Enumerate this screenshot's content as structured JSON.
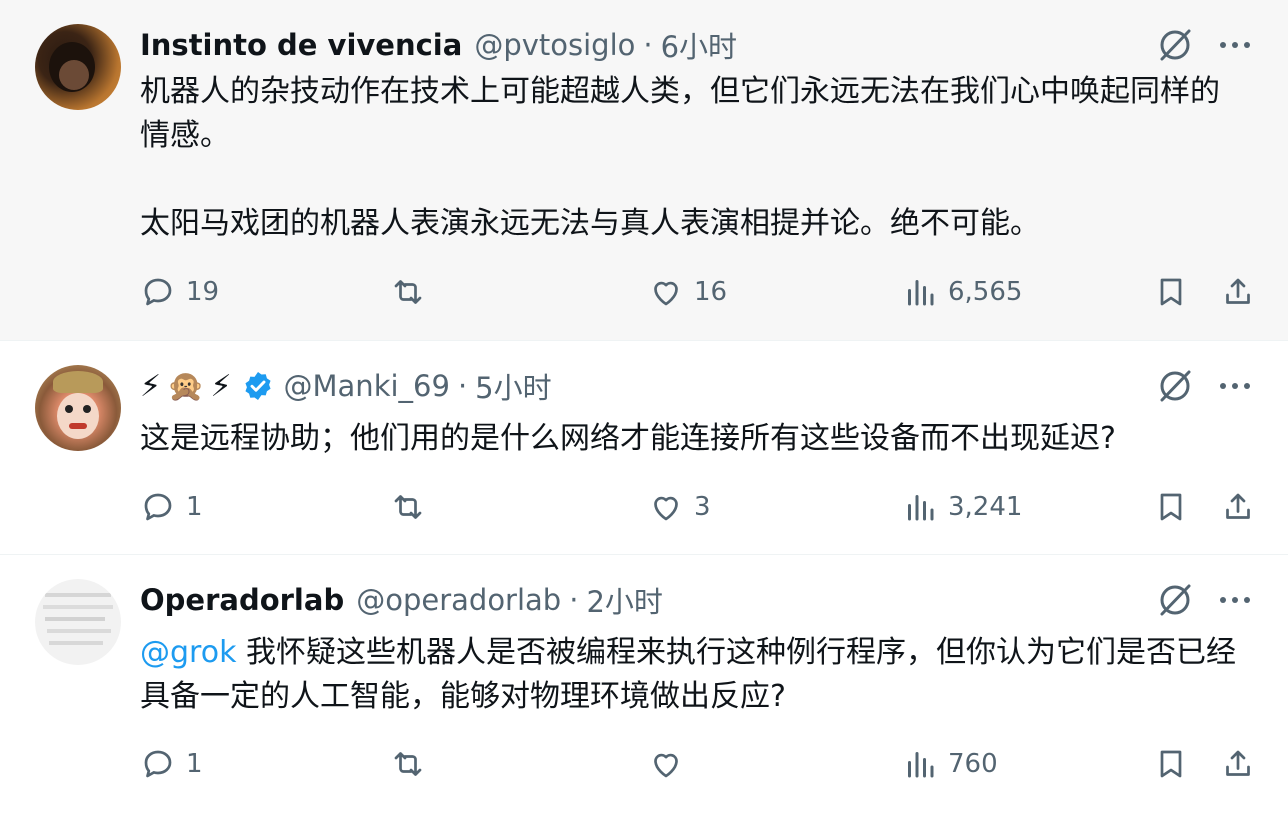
{
  "tweets": [
    {
      "name": "Instinto de vivencia",
      "handle": "@pvtosiglo",
      "time": "6小时",
      "text_p1": "机器人的杂技动作在技术上可能超越人类，但它们永远无法在我们心中唤起同样的情感。",
      "text_p2": "太阳马戏团的机器人表演永远无法与真人表演相提并论。绝不可能。",
      "replies": "19",
      "retweets": "",
      "likes": "16",
      "views": "6,565"
    },
    {
      "name_emojis": [
        "⚡",
        "🙊",
        "⚡"
      ],
      "handle": "@Manki_69",
      "time": "5小时",
      "text": "这是远程协助；他们用的是什么网络才能连接所有这些设备而不出现延迟?",
      "replies": "1",
      "retweets": "",
      "likes": "3",
      "views": "3,241"
    },
    {
      "name": "Operadorlab",
      "handle": "@operadorlab",
      "time": "2小时",
      "mention": "@grok",
      "text": " 我怀疑这些机器人是否被编程来执行这种例行程序，但你认为它们是否已经具备一定的人工智能，能够对物理环境做出反应?",
      "replies": "1",
      "retweets": "",
      "likes": "",
      "views": "760"
    }
  ],
  "colors": {
    "secondary_text": "#536471",
    "link": "#1d9bf0",
    "verified": "#1d9bf0",
    "highlight_bg": "#f7f7f7"
  },
  "icons": [
    "grok-slash-icon",
    "more-icon",
    "reply-icon",
    "retweet-icon",
    "like-icon",
    "views-icon",
    "bookmark-icon",
    "share-icon",
    "verified-badge-icon"
  ]
}
